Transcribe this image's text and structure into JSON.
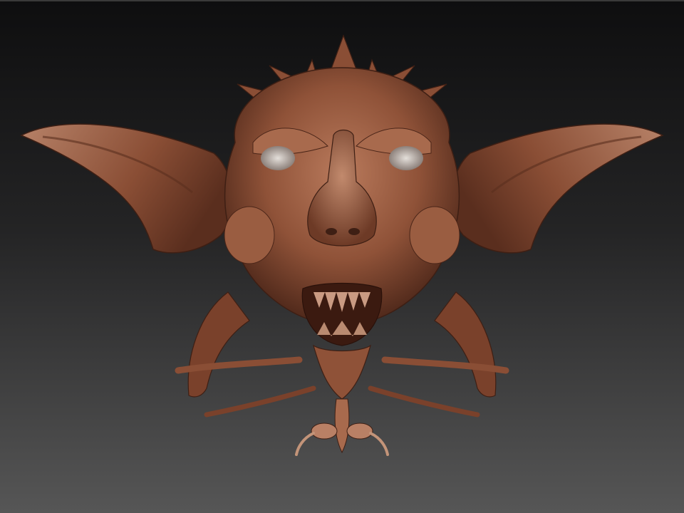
{
  "scene": {
    "subject": "creature-head-sculpt",
    "colors": {
      "background_top": "#0e0e0f",
      "background_bottom": "#545454",
      "skin_light": "#b97a5c",
      "skin_mid": "#8f5238",
      "skin_dark": "#4a2518",
      "eye": "#c9c2bc"
    }
  }
}
